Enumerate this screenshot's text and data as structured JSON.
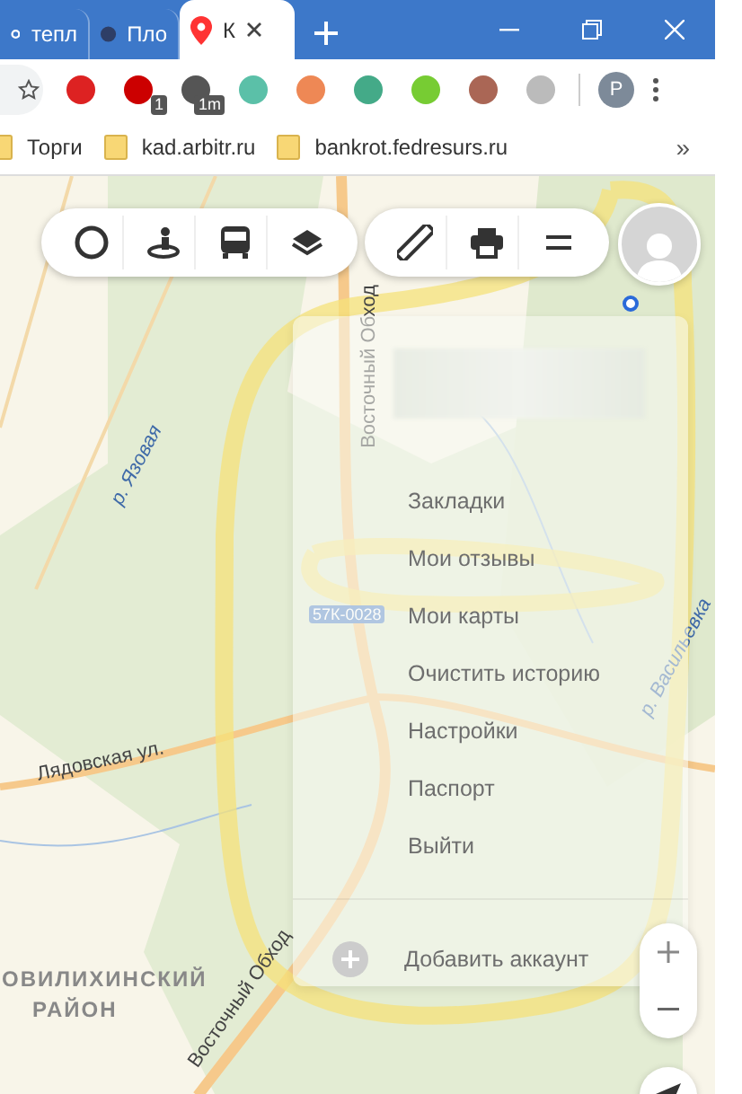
{
  "tabs": [
    {
      "title": "тепл",
      "selected": false
    },
    {
      "title": "Пло",
      "selected": false
    },
    {
      "title": "К",
      "selected": true
    }
  ],
  "extension_badges": [
    "1",
    "1m"
  ],
  "profile_letter": "P",
  "bookmarks": [
    "Торги",
    "kad.arbitr.ru",
    "bankrot.fedresurs.ru"
  ],
  "bookmarks_overflow": "»",
  "map_labels": [
    {
      "text": "р. Язовая",
      "kind": "river"
    },
    {
      "text": "Восточный Обход",
      "kind": "road"
    },
    {
      "text": "57К-0028",
      "kind": "shield"
    },
    {
      "text": "р. Васильевка",
      "kind": "river"
    },
    {
      "text": "Лядовская ул.",
      "kind": "road"
    },
    {
      "text": "Восточный Обход",
      "kind": "road"
    },
    {
      "text": "ОВИЛИХИНСКИЙ",
      "kind": "district"
    },
    {
      "text": "РАЙОН",
      "kind": "district"
    }
  ],
  "menu": {
    "items": [
      "Закладки",
      "Мои отзывы",
      "Мои карты",
      "Очистить историю",
      "Настройки",
      "Паспорт",
      "Выйти"
    ],
    "add_account": "Добавить аккаунт"
  }
}
